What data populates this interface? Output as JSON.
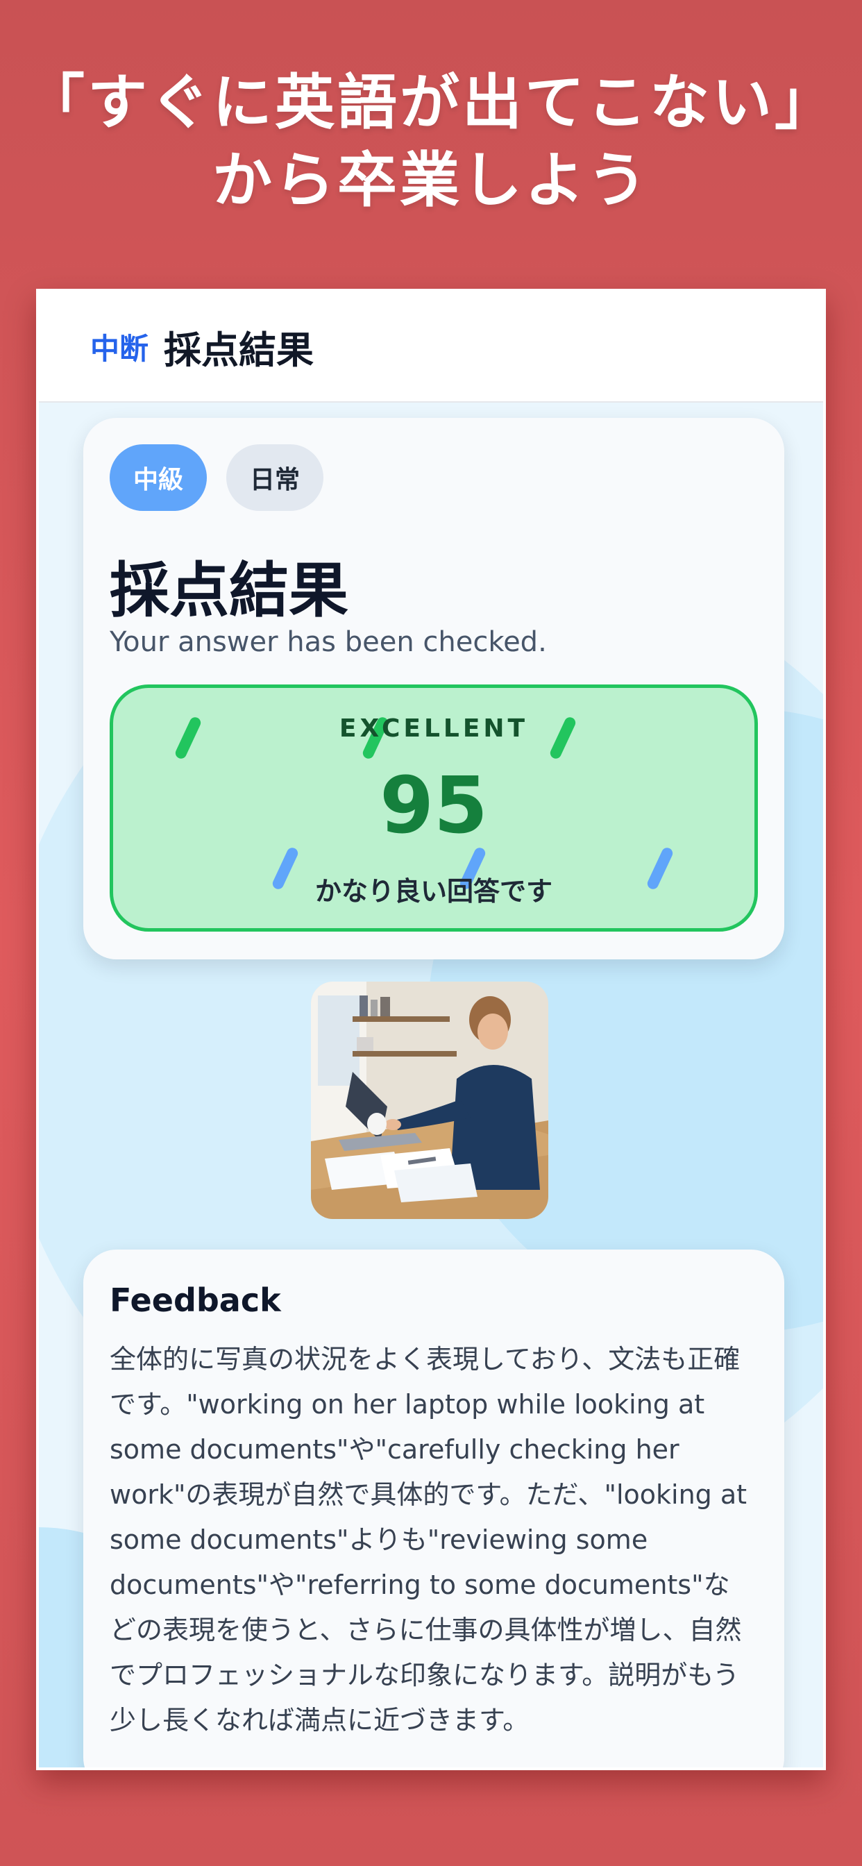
{
  "headline": {
    "line1": "「すぐに英語が出てこない」",
    "line2": "から卒業しよう"
  },
  "appbar": {
    "suspend_label": "中断",
    "title": "採点結果"
  },
  "result": {
    "chips": [
      "中級",
      "日常"
    ],
    "title": "採点結果",
    "subtitle": "Your answer has been checked.",
    "score_label": "EXCELLENT",
    "score": 95,
    "comment": "かなり良い回答です"
  },
  "photo": {
    "icon": "illustration-woman-working-laptop"
  },
  "feedback": {
    "title": "Feedback",
    "body": "全体的に写真の状況をよく表現しており、文法も正確です。\"working on her laptop while looking at some documents\"や\"carefully checking her work\"の表現が自然で具体的です。ただ、\"looking at some documents\"よりも\"reviewing some documents\"や\"referring to some documents\"などの表現を使うと、さらに仕事の具体性が増し、自然でプロフェッショナルな印象になります。説明がもう少し長くなれば満点に近づきます。"
  },
  "colors": {
    "background": "#d6575a",
    "accent_blue": "#2563eb",
    "score_green": "#15803d",
    "score_box": "#bbf1ce"
  }
}
